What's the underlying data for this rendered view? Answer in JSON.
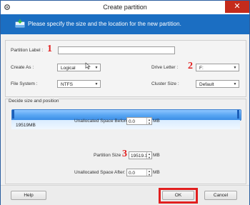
{
  "window": {
    "title": "Create partition",
    "close_glyph": "✕"
  },
  "banner": {
    "text": "Please specify the size and the location for the new partition."
  },
  "form": {
    "partition_label": {
      "label": "Partition Label :",
      "value": ""
    },
    "create_as": {
      "label": "Create As :",
      "value": "Logical"
    },
    "drive_letter": {
      "label": "Drive Letter :",
      "value": "F:"
    },
    "file_system": {
      "label": "File System :",
      "value": "NTFS"
    },
    "cluster_size": {
      "label": "Cluster Size :",
      "value": "Default"
    }
  },
  "size_group": {
    "title": "Decide size and position",
    "bar_label": "19519MB",
    "unallocated_before": {
      "label": "Unallocated Space Before:",
      "value": "0.0",
      "unit": "MB"
    },
    "partition_size": {
      "label": "Partition Size :",
      "value": "19519.1",
      "unit": "MB"
    },
    "unallocated_after": {
      "label": "Unallocated Space After:",
      "value": "0.0",
      "unit": "MB"
    }
  },
  "annotations": {
    "n1": "1",
    "n2": "2",
    "n3": "3"
  },
  "buttons": {
    "help": "Help",
    "ok": "OK",
    "cancel": "Cancel"
  },
  "colors": {
    "banner": "#1b6ec2",
    "annotation_red": "#e11f1f",
    "bar": "#5aa7f3"
  },
  "icons": {
    "app": "gear-icon",
    "banner": "partition-disk-icon",
    "dropdown": "chevron-down-icon",
    "spinner": "spin-arrows-icon"
  }
}
